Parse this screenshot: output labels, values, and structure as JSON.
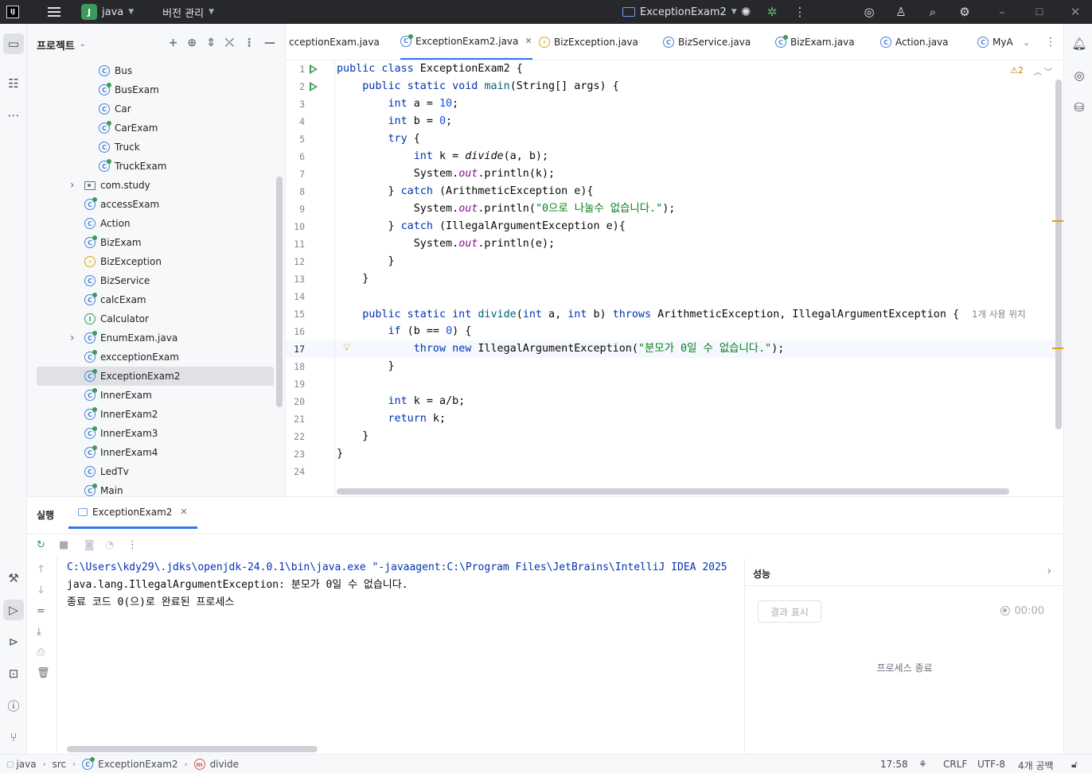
{
  "titlebar": {
    "project_badge": "J",
    "project_name": "java",
    "vcs_label": "버전 관리",
    "run_config": "ExceptionExam2"
  },
  "project_panel": {
    "title": "프로젝트",
    "items": [
      {
        "label": "Bus",
        "icon": "class-icon"
      },
      {
        "label": "BusExam",
        "icon": "main-class-icon"
      },
      {
        "label": "Car",
        "icon": "class-icon"
      },
      {
        "label": "CarExam",
        "icon": "main-class-icon"
      },
      {
        "label": "Truck",
        "icon": "class-icon"
      },
      {
        "label": "TruckExam",
        "icon": "main-class-icon"
      },
      {
        "label": "com.study",
        "icon": "package-icon"
      },
      {
        "label": "accessExam",
        "icon": "main-class-icon"
      },
      {
        "label": "Action",
        "icon": "class-icon"
      },
      {
        "label": "BizExam",
        "icon": "main-class-icon"
      },
      {
        "label": "BizException",
        "icon": "exception-class-icon"
      },
      {
        "label": "BizService",
        "icon": "class-icon"
      },
      {
        "label": "calcExam",
        "icon": "main-class-icon"
      },
      {
        "label": "Calculator",
        "icon": "interface-icon"
      },
      {
        "label": "EnumExam.java",
        "icon": "main-class-icon"
      },
      {
        "label": "excceptionExam",
        "icon": "main-class-icon"
      },
      {
        "label": "ExceptionExam2",
        "icon": "main-class-icon"
      },
      {
        "label": "InnerExam",
        "icon": "main-class-icon"
      },
      {
        "label": "InnerExam2",
        "icon": "main-class-icon"
      },
      {
        "label": "InnerExam3",
        "icon": "main-class-icon"
      },
      {
        "label": "InnerExam4",
        "icon": "main-class-icon"
      },
      {
        "label": "LedTv",
        "icon": "class-icon"
      },
      {
        "label": "Main",
        "icon": "main-class-icon"
      }
    ]
  },
  "tabs": [
    {
      "label": "cceptionExam.java"
    },
    {
      "label": "ExceptionExam2.java"
    },
    {
      "label": "BizException.java"
    },
    {
      "label": "BizService.java"
    },
    {
      "label": "BizExam.java"
    },
    {
      "label": "Action.java"
    },
    {
      "label": "MyA"
    }
  ],
  "editor": {
    "warning_count": "⚠2",
    "usage_hint": "1개 사용 위치",
    "line_numbers": [
      "1",
      "2",
      "3",
      "4",
      "5",
      "6",
      "7",
      "8",
      "9",
      "10",
      "11",
      "12",
      "13",
      "14",
      "15",
      "16",
      "17",
      "18",
      "19",
      "20",
      "21",
      "22",
      "23",
      "24"
    ],
    "code": {
      "l1_kw": "public class",
      "l1_rest": " ExceptionExam2 {",
      "l2_kw": "public static void",
      "l2_fn": "main",
      "l2_rest": "(String[] args) {",
      "l3_kw": "int",
      "l3_a": " a = ",
      "l3_num": "10",
      "l3_end": ";",
      "l4_kw": "int",
      "l4_a": " b = ",
      "l4_num": "0",
      "l4_end": ";",
      "l5_kw": "try",
      "l5_rest": " {",
      "l6_kw": "int",
      "l6_a": " k = ",
      "l6_call": "divide",
      "l6_rest": "(a, b);",
      "l7_a": "System.",
      "l7_fld": "out",
      "l7_rest": ".println(k);",
      "l8_a": "} ",
      "l8_kw": "catch",
      "l8_rest": " (ArithmeticException e){",
      "l9_a": "System.",
      "l9_fld": "out",
      "l9_b": ".println(",
      "l9_str": "\"0으로 나눌수 없습니다.\"",
      "l9_end": ");",
      "l10_a": "} ",
      "l10_kw": "catch",
      "l10_rest": " (IllegalArgumentException e){",
      "l11_a": "System.",
      "l11_fld": "out",
      "l11_rest": ".println(e);",
      "l12": "}",
      "l13": "}",
      "l15_kw": "public static int",
      "l15_fn": "divide",
      "l15_b": "(",
      "l15_kw2": "int",
      "l15_c": " a, ",
      "l15_kw3": "int",
      "l15_d": " b) ",
      "l15_kw4": "throws",
      "l15_rest": " ArithmeticException, IllegalArgumentException {",
      "l16_kw": "if",
      "l16_a": " (b == ",
      "l16_num": "0",
      "l16_rest": ") {",
      "l17_kw": "throw new",
      "l17_a": " IllegalArgumentException(",
      "l17_str": "\"분모가 0일 수 없습니다.\"",
      "l17_end": ");",
      "l18": "}",
      "l20_kw": "int",
      "l20_rest": " k = a/b;",
      "l21_kw": "return",
      "l21_rest": " k;",
      "l22": "}",
      "l23": "}"
    }
  },
  "run_panel": {
    "title": "실행",
    "tab_label": "ExceptionExam2",
    "console": {
      "line1": "C:\\Users\\kdy29\\.jdks\\openjdk-24.0.1\\bin\\java.exe \"-javaagent:C:\\Program Files\\JetBrains\\IntelliJ IDEA 2025",
      "line2": "java.lang.IllegalArgumentException: 분모가 0일 수 없습니다.",
      "line3": "",
      "line4": "종료 코드 0(으)로 완료된 프로세스"
    },
    "performance": {
      "title": "성능",
      "button": "결과 표시",
      "time": "00:00",
      "message": "프로세스 종료"
    }
  },
  "statusbar": {
    "crumbs": [
      "java",
      "src",
      "ExceptionExam2",
      "divide"
    ],
    "position": "17:58",
    "line_sep": "CRLF",
    "encoding": "UTF-8",
    "indent": "4개 공백"
  },
  "colors": {
    "accent": "#3574f0",
    "keyword": "#0033b3",
    "string": "#067d17",
    "number": "#1750eb",
    "run_green": "#3d9b5a"
  }
}
